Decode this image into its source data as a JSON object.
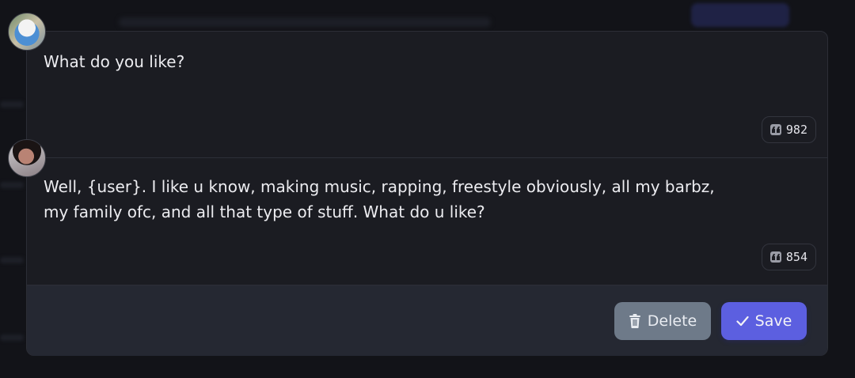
{
  "messages": [
    {
      "text": "What do you like?",
      "token_count": "982",
      "avatar_icon": "user-avatar-icon"
    },
    {
      "text": "Well, {user}. I like u know, making music, rapping, freestyle obviously, all my barbz,\nmy family ofc, and all that type of stuff. What do u like?",
      "token_count": "854",
      "avatar_icon": "character-avatar-icon"
    }
  ],
  "footer": {
    "delete_label": "Delete",
    "save_label": "Save",
    "delete_icon": "trash-icon",
    "save_icon": "check-icon"
  },
  "colors": {
    "save_button": "#5c5fe0",
    "delete_button": "#6e7a89",
    "panel": "#1b1c22"
  }
}
